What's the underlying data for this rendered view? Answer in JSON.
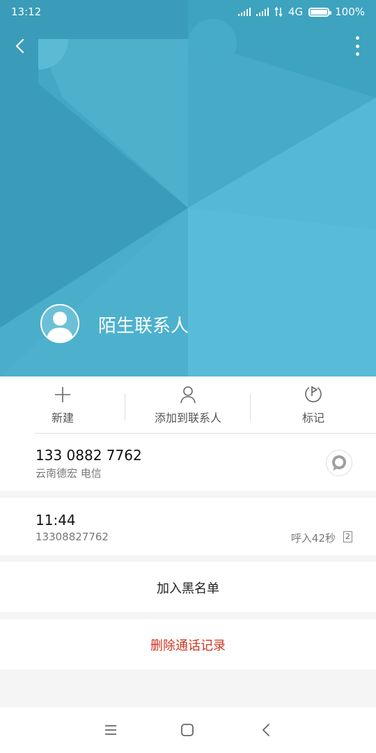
{
  "status_bar": {
    "time": "13:12",
    "network": "4G",
    "battery": "100%",
    "battery_level": 1.0
  },
  "header": {
    "contact_name": "陌生联系人",
    "icons": [
      "back-icon",
      "more-vertical-icon",
      "avatar-icon"
    ]
  },
  "actions": [
    {
      "label": "新建",
      "icon": "plus-icon"
    },
    {
      "label": "添加到联系人",
      "icon": "person-icon"
    },
    {
      "label": "标记",
      "icon": "flag-icon"
    }
  ],
  "phone": {
    "number": "133 0882 7762",
    "location": "云南德宏 电信",
    "icon": "message-icon"
  },
  "call_log": {
    "time": "11:44",
    "number": "13308827762",
    "info": "呼入42秒",
    "count": "2"
  },
  "buttons": {
    "blacklist": "加入黑名单",
    "delete": "删除通话记录"
  },
  "colors": {
    "header_bg": "#3ea4c0",
    "delete_text": "#d0331f"
  }
}
